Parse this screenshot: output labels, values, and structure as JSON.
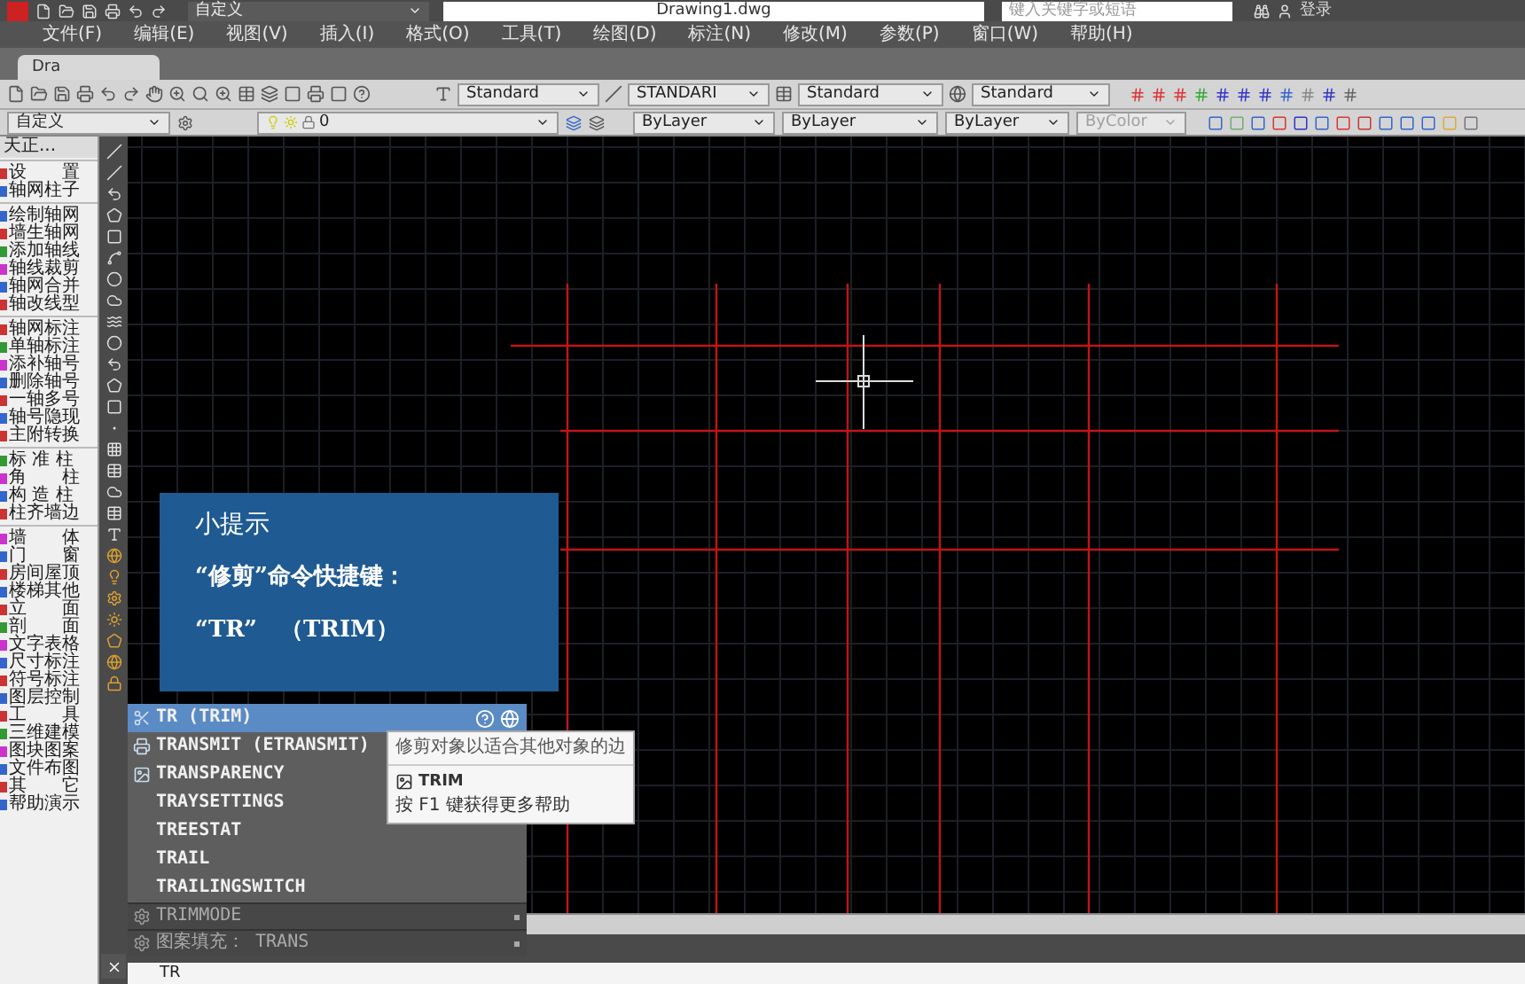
{
  "title_bar": {
    "workspace": "自定义",
    "title": "Drawing1.dwg",
    "search_placeholder": "键入关键字或短语",
    "login": "登录"
  },
  "menu": [
    "文件(F)",
    "编辑(E)",
    "视图(V)",
    "插入(I)",
    "格式(O)",
    "工具(T)",
    "绘图(D)",
    "标注(N)",
    "修改(M)",
    "参数(P)",
    "窗口(W)",
    "帮助(H)"
  ],
  "tabs": [
    {
      "label": "Dra",
      "selected": true
    }
  ],
  "style_toolbar": [
    "Standard",
    "STANDARI",
    "Standard",
    "Standard"
  ],
  "properties_toolbar": {
    "workspace": "自定义",
    "layer": "0",
    "layer_color": "ByLayer",
    "linetype": "ByLayer",
    "lineweight": "ByLayer",
    "plot_style": {
      "label": "ByColor",
      "disabled": true
    }
  },
  "palette": {
    "title": "天正...",
    "groups": [
      [
        "设　　置",
        "轴网柱子"
      ],
      [
        "绘制轴网",
        "墙生轴网",
        "添加轴线",
        "轴线裁剪",
        "轴网合并",
        "轴改线型"
      ],
      [
        "轴网标注",
        "单轴标注",
        "添补轴号",
        "删除轴号",
        "一轴多号",
        "轴号隐现",
        "主附转换"
      ],
      [
        "标 准 柱",
        "角　　柱",
        "构 造 柱",
        "柱齐墙边"
      ],
      [
        "墙　　体",
        "门　　窗",
        "房间屋顶",
        "楼梯其他",
        "立　　面",
        "剖　　面",
        "文字表格",
        "尺寸标注",
        "符号标注",
        "图层控制",
        "工　　具",
        "三维建模",
        "图块图案",
        "文件布图",
        "其　　它",
        "帮助演示"
      ]
    ]
  },
  "tip": {
    "title": "小提示",
    "lines": [
      "“修剪”命令快捷键：",
      "“TR”　（TRIM）"
    ]
  },
  "autocomplete": [
    {
      "kind": "command",
      "label": "TR (TRIM)",
      "selected": true
    },
    {
      "kind": "command",
      "label": "TRANSMIT (ETRANSMIT)",
      "selected": false
    },
    {
      "kind": "command",
      "label": "TRANSPARENCY",
      "selected": false
    },
    {
      "kind": "command",
      "label": "TRAYSETTINGS",
      "selected": false
    },
    {
      "kind": "command",
      "label": "TREESTAT",
      "selected": false
    },
    {
      "kind": "command",
      "label": "TRAIL",
      "selected": false
    },
    {
      "kind": "command",
      "label": "TRAILINGSWITCH",
      "selected": false
    },
    {
      "kind": "category",
      "label": "TRIMMODE",
      "selected": false
    },
    {
      "kind": "category",
      "label": "图案填充： TRANS",
      "selected": false
    }
  ],
  "tooltip": {
    "description": "修剪对象以适合其他对象的边",
    "command": "TRIM",
    "help": "按 F1 键获得更多帮助"
  },
  "command_line": {
    "input": "TR"
  }
}
